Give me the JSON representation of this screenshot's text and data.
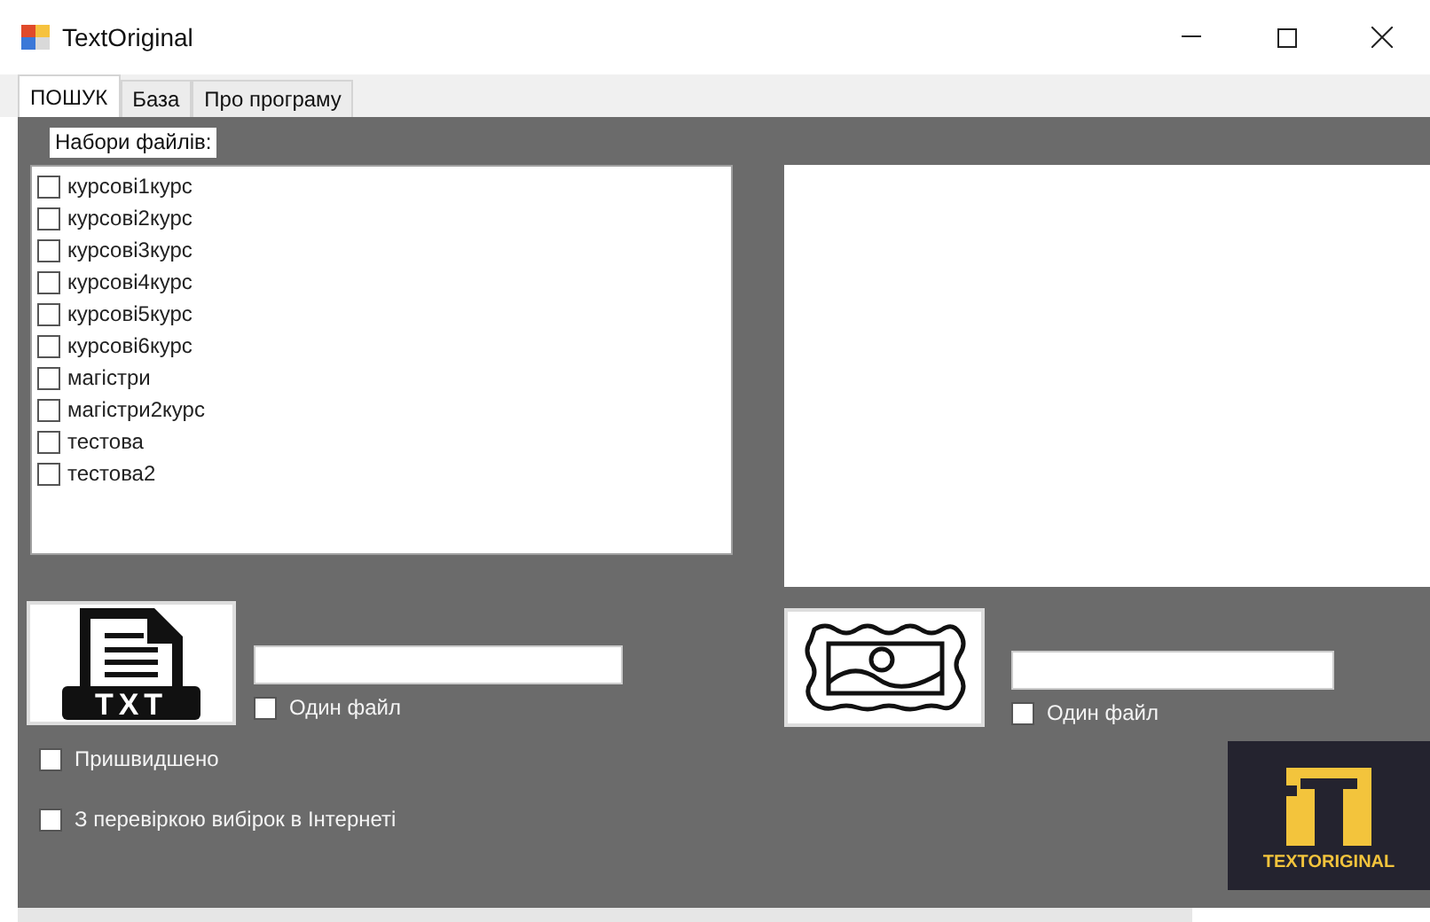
{
  "window": {
    "title": "TextOriginal"
  },
  "tabs": [
    {
      "label": "ПОШУК",
      "selected": true
    },
    {
      "label": "База",
      "selected": false
    },
    {
      "label": "Про програму",
      "selected": false
    }
  ],
  "file_sets": {
    "label": "Набори файлів:",
    "items": [
      {
        "label": "курсові1курс",
        "checked": false
      },
      {
        "label": "курсові2курс",
        "checked": false
      },
      {
        "label": "курсові3курс",
        "checked": false
      },
      {
        "label": "курсові4курс",
        "checked": false
      },
      {
        "label": "курсові5курс",
        "checked": false
      },
      {
        "label": "курсові6курс",
        "checked": false
      },
      {
        "label": "магістри",
        "checked": false
      },
      {
        "label": "магістри2курс",
        "checked": false
      },
      {
        "label": "тестова",
        "checked": false
      },
      {
        "label": "тестова2",
        "checked": false
      }
    ]
  },
  "text_source": {
    "icon_text": "TXT",
    "one_file": {
      "label": "Один файл",
      "checked": false
    }
  },
  "options": [
    {
      "label": "Пришвидшено",
      "checked": false
    },
    {
      "label": "З перевіркою вибірок в Інтернеті",
      "checked": false
    }
  ],
  "image_source": {
    "one_file": {
      "label": "Один файл",
      "checked": false
    }
  },
  "logo": {
    "text": "TEXTORIGINAL"
  }
}
